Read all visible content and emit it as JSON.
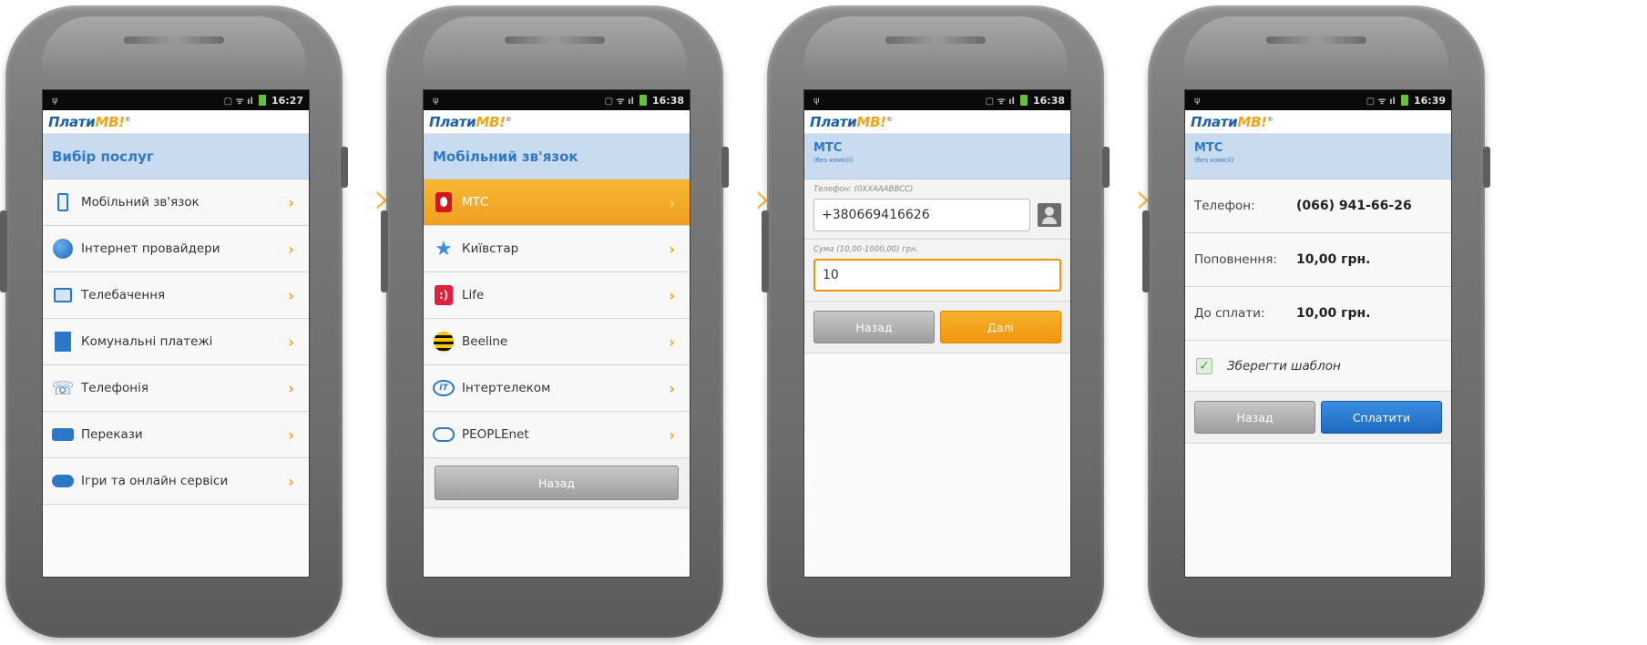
{
  "brand": {
    "logo_main": "Плати",
    "logo_mb": "MB!",
    "logo_mark": "®"
  },
  "screens": [
    {
      "time": "16:27",
      "title": "Вибір послуг",
      "items": [
        {
          "label": "Мобільний зв'язок",
          "icon": "mobile-phone-icon"
        },
        {
          "label": "Інтернет провайдери",
          "icon": "globe-icon"
        },
        {
          "label": "Телебачення",
          "icon": "tv-icon"
        },
        {
          "label": "Комунальні платежі",
          "icon": "building-icon"
        },
        {
          "label": "Телефонія",
          "icon": "telephone-icon"
        },
        {
          "label": "Перекази",
          "icon": "transfer-icon"
        },
        {
          "label": "Ігри та онлайн сервіси",
          "icon": "gamepad-icon"
        }
      ]
    },
    {
      "time": "16:38",
      "title": "Мобільний зв'язок",
      "items": [
        {
          "label": "МТС",
          "icon": "mts-icon",
          "active": true
        },
        {
          "label": "Київстар",
          "icon": "kyivstar-star-icon"
        },
        {
          "label": "Life",
          "icon": "life-icon"
        },
        {
          "label": "Beeline",
          "icon": "beeline-icon"
        },
        {
          "label": "Інтертелеком",
          "icon": "intertelecom-icon"
        },
        {
          "label": "PEOPLEnet",
          "icon": "peoplenet-icon"
        }
      ],
      "back": "Назад"
    },
    {
      "time": "16:38",
      "title": "МТС",
      "subtitle": "(без комісії)",
      "phone_label": "Телефон: (0XXAAABBCC)",
      "phone_value": "+380669416626",
      "sum_label": "Сума (10,00-1000,00) грн.",
      "sum_value": "10",
      "back": "Назад",
      "next": "Далі"
    },
    {
      "time": "16:39",
      "title": "МТС",
      "subtitle": "(без комісії)",
      "rows": [
        {
          "key": "Телефон:",
          "value": "(066) 941-66-26"
        },
        {
          "key": "Поповнення:",
          "value": "10,00 грн."
        },
        {
          "key": "До сплати:",
          "value": "10,00 грн."
        }
      ],
      "save_template": "Зберегти шаблон",
      "save_checked": true,
      "back": "Назад",
      "pay": "Сплатити"
    }
  ],
  "arrow_glyph": "›",
  "chevron_glyph": "›"
}
